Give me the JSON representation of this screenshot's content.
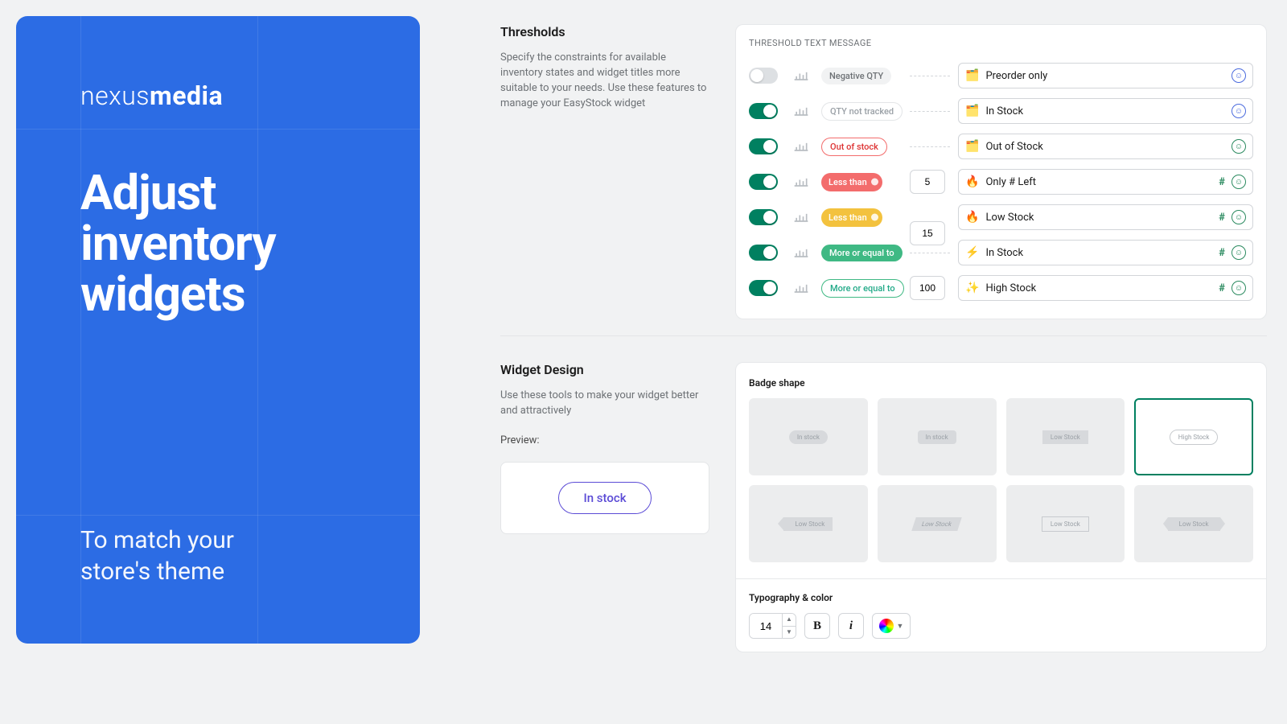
{
  "promo": {
    "brand_light": "nexus",
    "brand_bold": "media",
    "title_l1": "Adjust inventory",
    "title_l2": "widgets",
    "subtitle_l1": "To match your",
    "subtitle_l2": "store's theme"
  },
  "thresholds": {
    "heading": "Thresholds",
    "description": "Specify the constraints for available inventory states and widget titles more suitable to your needs. Use these features to manage your EasyStock widget",
    "panel_title": "THRESHOLD TEXT MESSAGE",
    "rows": [
      {
        "on": false,
        "chip": "Negative QTY",
        "chip_style": "gray",
        "value": "",
        "emoji": "🗂️",
        "text": "Preorder only",
        "has_hash": false,
        "smile": "blue"
      },
      {
        "on": true,
        "chip": "QTY not tracked",
        "chip_style": "dim",
        "value": "",
        "emoji": "🗂️",
        "text": "In Stock",
        "has_hash": false,
        "smile": "blue"
      },
      {
        "on": true,
        "chip": "Out of stock",
        "chip_style": "red",
        "value": "",
        "emoji": "🗂️",
        "text": "Out of Stock",
        "has_hash": false,
        "smile": "green"
      },
      {
        "on": true,
        "chip": "Less than",
        "chip_style": "redf",
        "value": "5",
        "emoji": "🔥",
        "text": "Only # Left",
        "has_hash": true,
        "smile": "green"
      },
      {
        "on": true,
        "chip": "Less than",
        "chip_style": "orange",
        "value": "15",
        "emoji": "🔥",
        "text": "Low Stock",
        "has_hash": true,
        "smile": "green",
        "offset_value": true
      },
      {
        "on": true,
        "chip": "More or equal to",
        "chip_style": "greenf",
        "value": "",
        "emoji": "⚡",
        "text": "In Stock",
        "has_hash": true,
        "smile": "green"
      },
      {
        "on": true,
        "chip": "More or equal to",
        "chip_style": "green",
        "value": "100",
        "emoji": "✨",
        "text": "High Stock",
        "has_hash": true,
        "smile": "green"
      }
    ]
  },
  "design": {
    "heading": "Widget Design",
    "description": "Use these tools to make your widget better and attractively",
    "preview_label": "Preview:",
    "preview_text": "In stock",
    "badge_title": "Badge shape",
    "shapes": [
      {
        "label": "In stock",
        "cls": "sb-pill"
      },
      {
        "label": "In stock",
        "cls": "sb-round"
      },
      {
        "label": "Low Stock",
        "cls": "sb-sharp"
      },
      {
        "label": "High Stock",
        "cls": "sb-outline sb-pill",
        "selected": true
      },
      {
        "label": "Low Stock",
        "cls": "sb-arrow"
      },
      {
        "label": "Low Stock",
        "cls": "sb-para"
      },
      {
        "label": "Low Stock",
        "cls": "sb-outline"
      },
      {
        "label": "Low Stock",
        "cls": "sb-ribbon"
      }
    ],
    "typo_title": "Typography & color",
    "font_size": "14"
  }
}
